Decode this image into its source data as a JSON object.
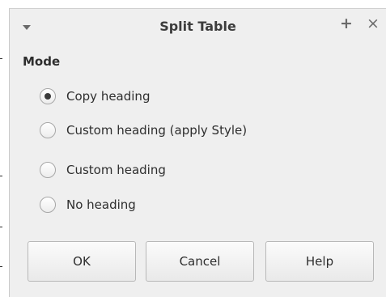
{
  "dialog": {
    "title": "Split Table",
    "menu_icon": "chevron-down-icon",
    "plus_icon": "+",
    "close_icon": "×"
  },
  "mode": {
    "label": "Mode",
    "options": [
      {
        "label": "Copy heading",
        "checked": true
      },
      {
        "label": "Custom heading (apply Style)",
        "checked": false
      },
      {
        "label": "Custom heading",
        "checked": false
      },
      {
        "label": "No heading",
        "checked": false
      }
    ]
  },
  "buttons": {
    "ok": "OK",
    "cancel": "Cancel",
    "help": "Help"
  }
}
